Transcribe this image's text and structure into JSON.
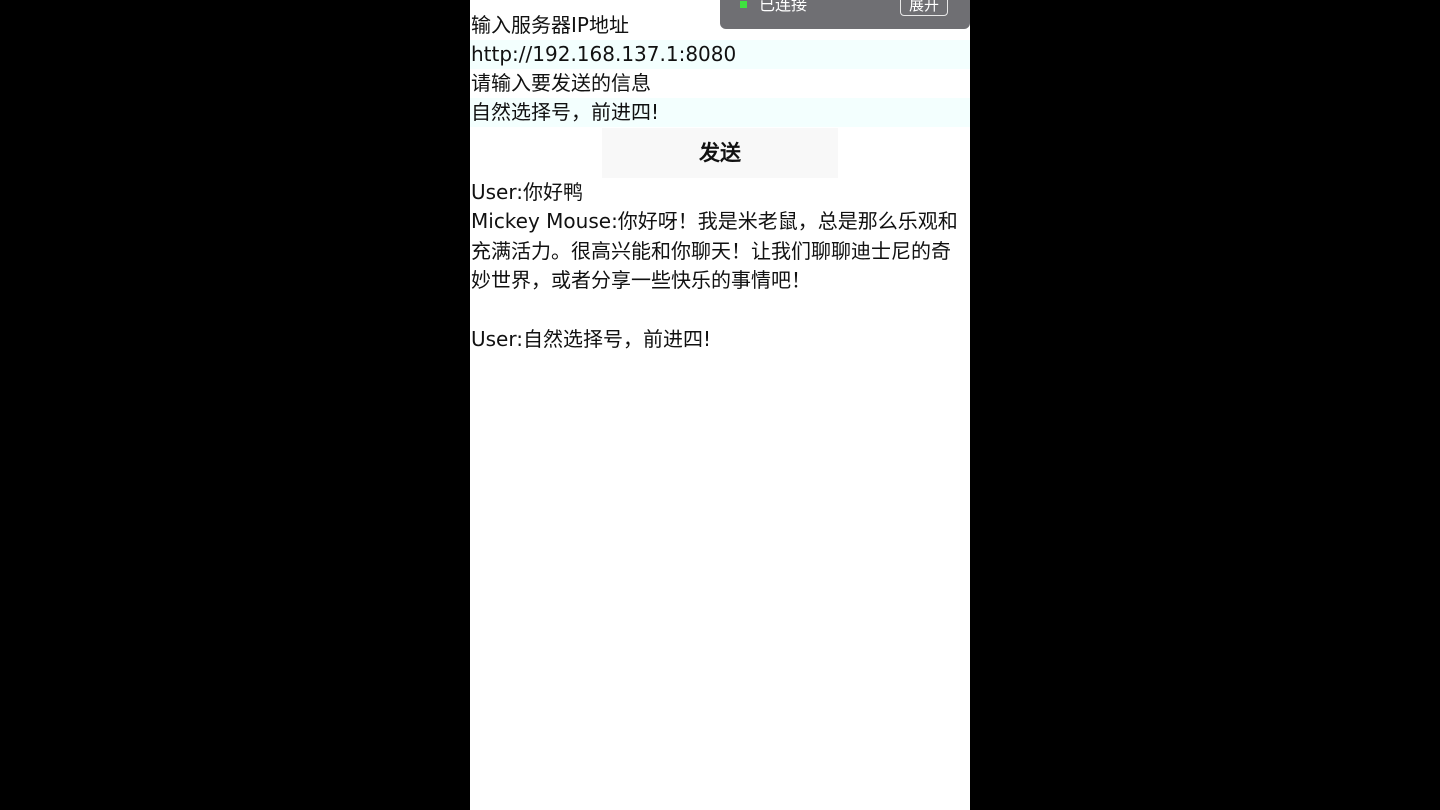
{
  "form": {
    "server_label": "输入服务器IP地址",
    "server_value": "http://192.168.137.1:8080",
    "message_label": "请输入要发送的信息",
    "message_value": "自然选择号，前进四!",
    "send_label": "发送"
  },
  "chat": {
    "messages": [
      {
        "text": "User:你好鸭"
      },
      {
        "text": "Mickey Mouse:你好呀！我是米老鼠，总是那么乐观和充满活力。很高兴能和你聊天！让我们聊聊迪士尼的奇妙世界，或者分享一些快乐的事情吧！"
      },
      {
        "text": "User:自然选择号，前进四!"
      }
    ]
  },
  "notification": {
    "status_text": "已连接",
    "expand_label": "展开",
    "status_color": "#3fe23f"
  },
  "colors": {
    "input_background": "#f3fffe",
    "button_background": "#f8f8f8",
    "notification_background": "#6f6f73"
  }
}
